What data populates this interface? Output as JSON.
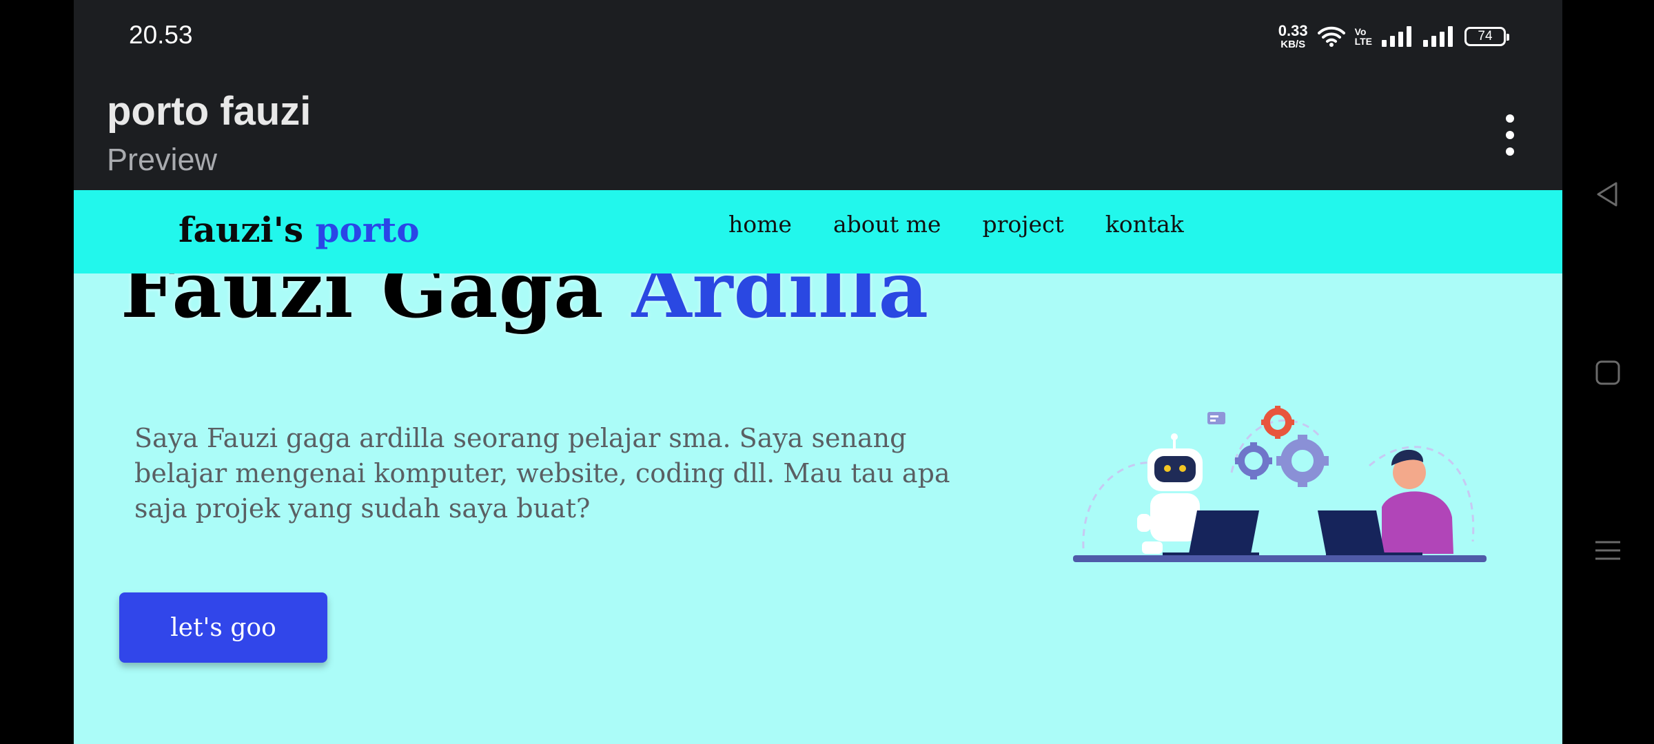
{
  "status_bar": {
    "time": "20.53",
    "net_speed_value": "0.33",
    "net_speed_unit": "KB/S",
    "volte_top": "Vo",
    "volte_bottom": "LTE",
    "battery": "74",
    "icons": [
      "wifi-icon",
      "volte-icon",
      "signal-icon",
      "signal-icon",
      "battery-icon"
    ]
  },
  "app_bar": {
    "title": "porto fauzi",
    "subtitle": "Preview",
    "menu_icon": "more-vert-icon"
  },
  "site": {
    "brand_main": "fauzi's",
    "brand_accent": "porto",
    "nav": [
      {
        "label": "home"
      },
      {
        "label": "about me"
      },
      {
        "label": "project"
      },
      {
        "label": "kontak"
      }
    ],
    "hero": {
      "title_main": "Fauzi Gaga",
      "title_accent": "Ardilla",
      "description": "Saya Fauzi gaga ardilla seorang pelajar sma. Saya senang belajar mengenai komputer, website, coding dll. Mau tau apa saja projek yang sudah saya buat?",
      "button": "let's goo",
      "illustration": "robot-and-developer-illustration"
    },
    "colors": {
      "nav_bg": "#22f7ec",
      "page_bg": "#abfcf8",
      "accent": "#2a48e2",
      "button_bg": "#3146ea"
    }
  },
  "system_nav": {
    "keys": [
      "back-icon",
      "home-icon",
      "recents-icon"
    ]
  }
}
